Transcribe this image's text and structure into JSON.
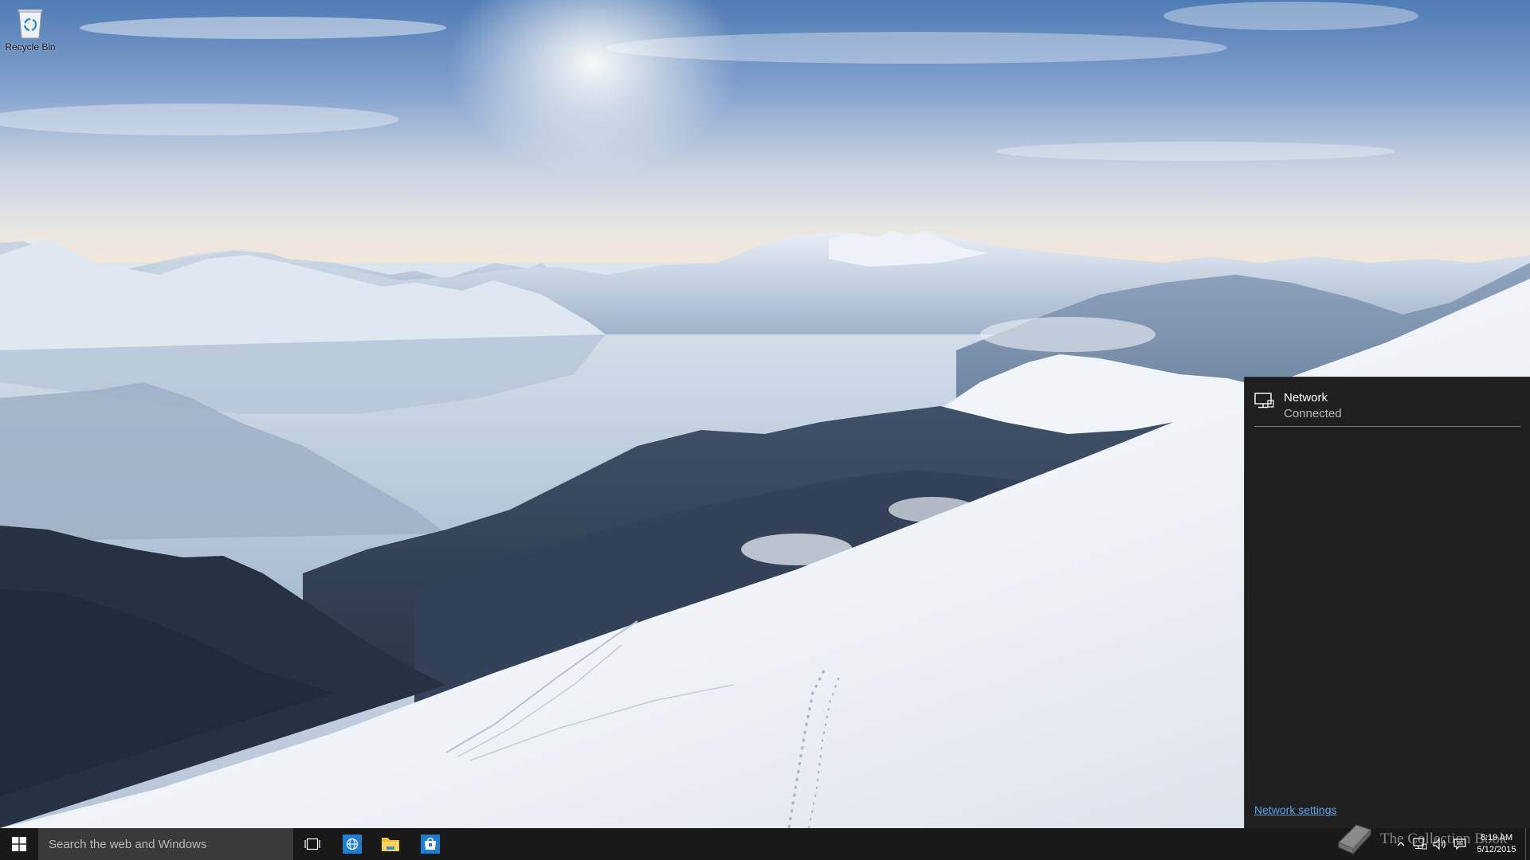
{
  "desktop": {
    "icons": [
      {
        "label": "Recycle Bin",
        "icon": "recycle-bin-icon"
      }
    ]
  },
  "network_flyout": {
    "network_name": "Network",
    "network_status": "Connected",
    "settings_link": "Network settings",
    "icon": "wired-network-icon"
  },
  "taskbar": {
    "start_icon": "windows-logo-icon",
    "search_placeholder": "Search the web and Windows",
    "pinned": [
      {
        "name": "task-view",
        "icon": "task-view-icon"
      },
      {
        "name": "internet-explorer",
        "icon": "browser-globe-icon"
      },
      {
        "name": "file-explorer",
        "icon": "folder-icon"
      },
      {
        "name": "store",
        "icon": "store-bag-icon"
      }
    ],
    "tray": {
      "icons": [
        "chevron-up-icon",
        "network-icon",
        "volume-icon",
        "action-center-icon"
      ],
      "time": "8:19 AM",
      "date": "5/12/2015"
    }
  },
  "watermark": {
    "text": "The Collection Book"
  },
  "colors": {
    "taskbar": "#191919",
    "search_box": "#3a3a3a",
    "flyout_bg": "#1f1f1f",
    "link": "#5aa5ea",
    "accent": "#0078d7"
  }
}
